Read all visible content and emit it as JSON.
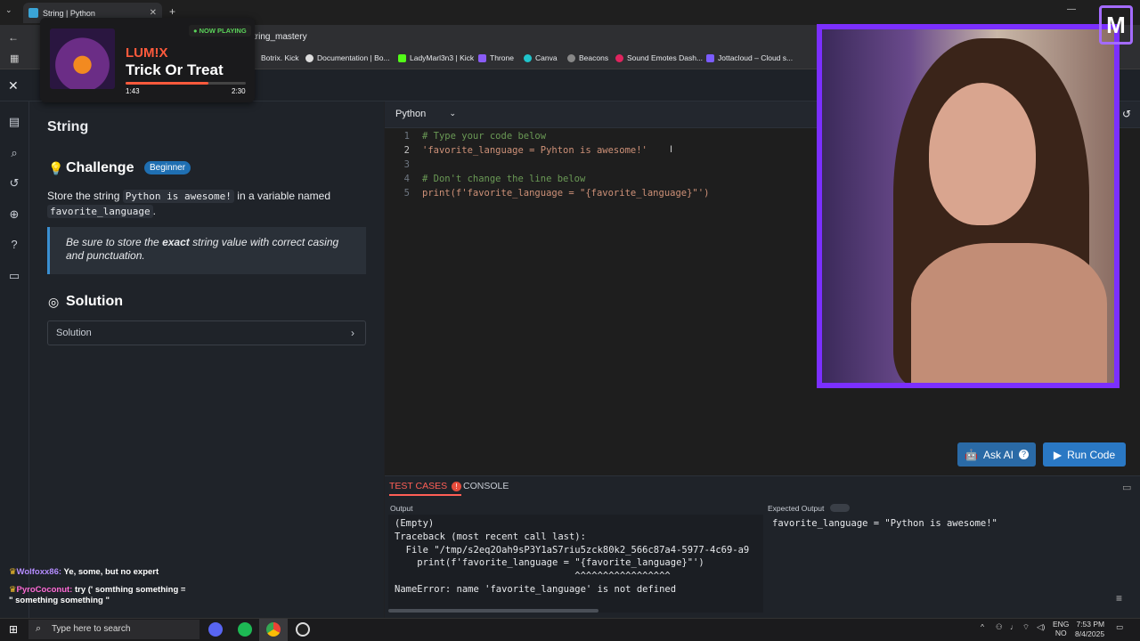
{
  "browser": {
    "tab_title": "String | Python",
    "url": "tring_mastery",
    "bookmarks": [
      "Botrix. Kick",
      "Documentation | Bo...",
      "LadyMarl3n3 | Kick",
      "Throne",
      "Canva",
      "Beacons",
      "Sound Emotes Dash...",
      "Jottacloud – Cloud s..."
    ]
  },
  "sidebar": {
    "title": "String",
    "challenge_heading": "Challenge",
    "level_badge": "Beginner",
    "desc_prefix": "Store the string",
    "desc_code1": "Python is awesome!",
    "desc_mid": "in a variable named",
    "desc_code2": "favorite_language",
    "desc_suffix": ".",
    "note_pre": "Be sure to store the",
    "note_bold": "exact",
    "note_post": "string value with correct casing and punctuation.",
    "solution_heading": "Solution",
    "solution_row": "Solution"
  },
  "editor": {
    "language": "Python",
    "lines": [
      {
        "n": "1",
        "text": "# Type your code below"
      },
      {
        "n": "2",
        "text": "'favorite_language = Pyhton is awesome!'"
      },
      {
        "n": "3",
        "text": ""
      },
      {
        "n": "4",
        "text": "# Don't change the line below"
      },
      {
        "n": "5",
        "text": "print(f'favorite_language = \"{favorite_language}\"')"
      }
    ],
    "ask_ai_label": "Ask AI",
    "run_label": "Run Code"
  },
  "results": {
    "tab_testcases": "TEST CASES",
    "tab_console": "CONSOLE",
    "output_label": "Output",
    "output_lines": [
      "(Empty)",
      "Traceback (most recent call last):",
      "  File \"/tmp/s2eq2Oah9sP3Y1aS7riu5zck80k2_566c87a4-5977-4c69-a9",
      "    print(f'favorite_language = \"{favorite_language}\"')",
      "                                ^^^^^^^^^^^^^^^^^",
      "NameError: name 'favorite_language' is not defined"
    ],
    "expected_label": "Expected Output",
    "expected_value": "favorite_language = \"Python is awesome!\""
  },
  "now_playing": {
    "badge": "NOW PLAYING",
    "artist": "LUM!X",
    "title": "Trick Or Treat",
    "elapsed": "1:43",
    "duration": "2:30",
    "progress": 0.69
  },
  "chat": [
    {
      "user": "Wolfoxx86:",
      "msg": "Ye, some, but no expert"
    },
    {
      "user": "PyroCoconut:",
      "msg": "try (' somthing something = \" something something \""
    }
  ],
  "taskbar": {
    "search_placeholder": "Type here to search",
    "lang1": "ENG",
    "lang2": "NO",
    "time": "7:53 PM",
    "date": "8/4/2025"
  },
  "colors": {
    "accent": "#2a78c4",
    "webcam_border": "#7b2fff",
    "error": "#ff5f56"
  }
}
